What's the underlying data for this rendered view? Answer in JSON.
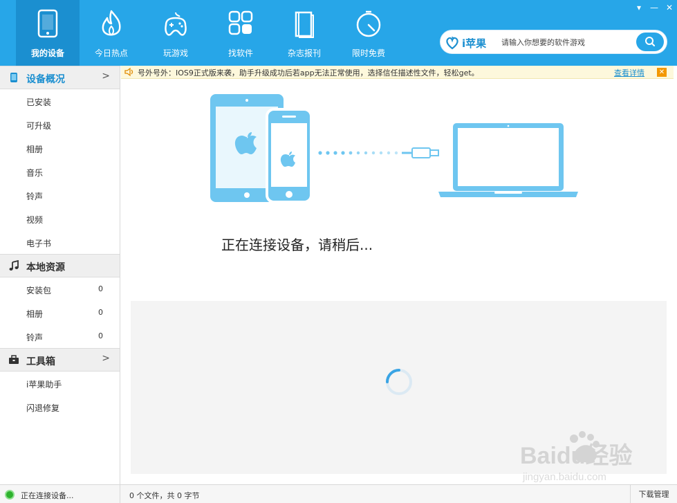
{
  "window": {
    "controls": [
      "▾",
      "—",
      "✕"
    ]
  },
  "nav": [
    {
      "label": "我的设备",
      "icon": "tablet-icon",
      "active": true
    },
    {
      "label": "今日热点",
      "icon": "flame-icon",
      "active": false
    },
    {
      "label": "玩游戏",
      "icon": "gamepad-icon",
      "active": false
    },
    {
      "label": "找软件",
      "icon": "apps-grid-icon",
      "active": false
    },
    {
      "label": "杂志报刊",
      "icon": "book-icon",
      "active": false
    },
    {
      "label": "限时免费",
      "icon": "timer-icon",
      "active": false
    }
  ],
  "search": {
    "logo_text": "i苹果",
    "placeholder": "请输入你想要的软件游戏"
  },
  "sidebar": {
    "device": {
      "title": "设备概况",
      "items": [
        "已安装",
        "可升级",
        "相册",
        "音乐",
        "铃声",
        "视频",
        "电子书"
      ]
    },
    "local": {
      "title": "本地资源",
      "items": [
        {
          "label": "安装包",
          "count": "0"
        },
        {
          "label": "相册",
          "count": "0"
        },
        {
          "label": "铃声",
          "count": "0"
        }
      ]
    },
    "tools": {
      "title": "工具箱",
      "items": [
        "i苹果助手",
        "闪退修复"
      ]
    }
  },
  "notice": {
    "text": "号外号外：IOS9正式版来袭，助手升级成功后若app无法正常使用，选择信任描述性文件，轻松get。",
    "link": "查看详情",
    "close": "✕"
  },
  "main": {
    "connecting_message": "正在连接设备，请稍后..."
  },
  "watermark": {
    "brand": "Baidu经验",
    "url": "jingyan.baidu.com"
  },
  "statusbar": {
    "status": "正在连接设备...",
    "file_summary": "0 个文件，共 0 字节",
    "download": "下载管理"
  },
  "colors": {
    "primary": "#27a6e8",
    "active_nav": "#1b8fd0",
    "illustration": "#6ec6f0",
    "notice_bg": "#fdf8dc"
  }
}
